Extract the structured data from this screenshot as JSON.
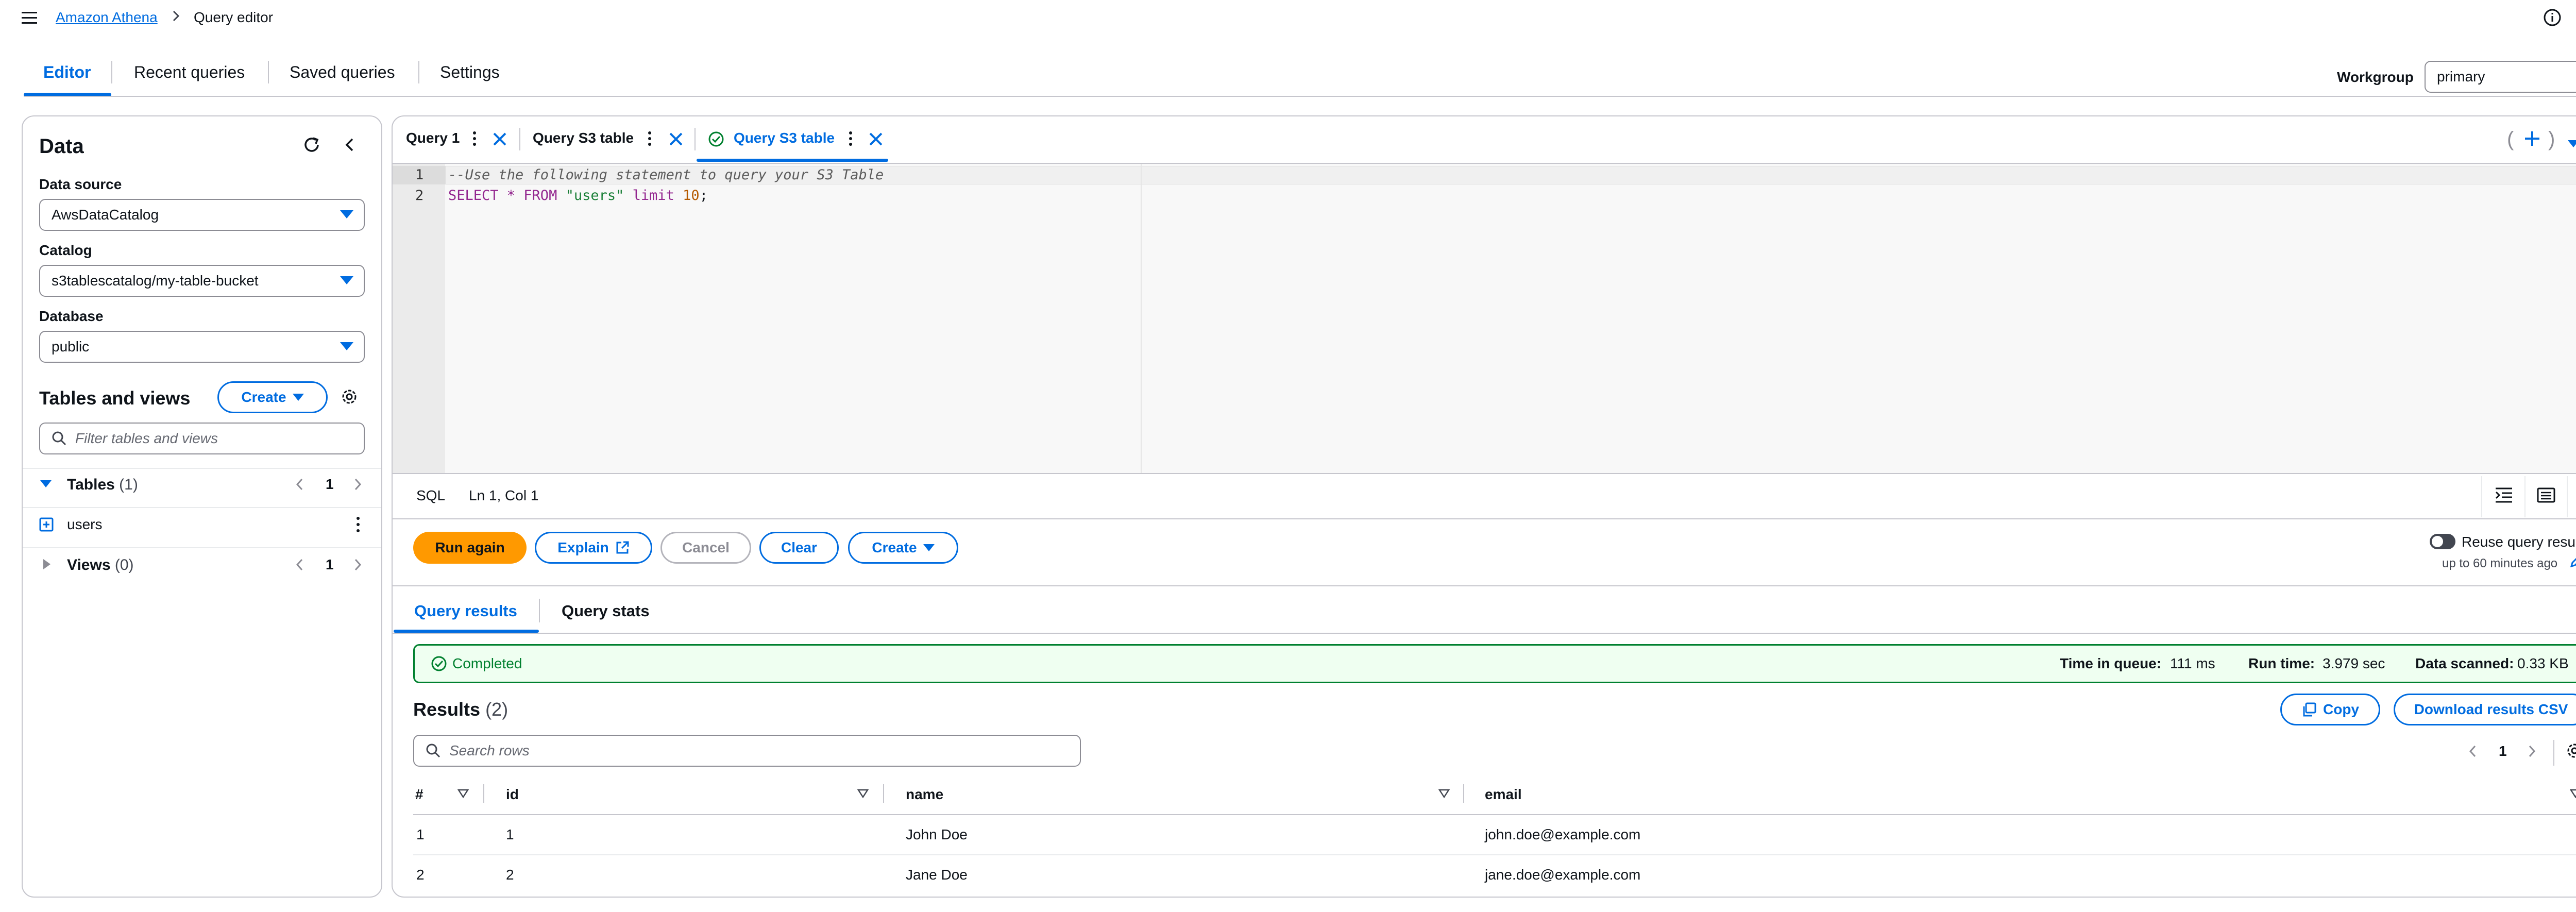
{
  "breadcrumb": {
    "service": "Amazon Athena",
    "current": "Query editor"
  },
  "page_tabs": [
    {
      "label": "Editor",
      "active": true
    },
    {
      "label": "Recent queries"
    },
    {
      "label": "Saved queries"
    },
    {
      "label": "Settings"
    }
  ],
  "workgroup": {
    "label": "Workgroup",
    "value": "primary"
  },
  "data_panel": {
    "title": "Data",
    "data_source": {
      "label": "Data source",
      "value": "AwsDataCatalog"
    },
    "catalog": {
      "label": "Catalog",
      "value": "s3tablescatalog/my-table-bucket"
    },
    "database": {
      "label": "Database",
      "value": "public"
    },
    "tables_and_views": {
      "title": "Tables and views",
      "create_label": "Create",
      "filter_placeholder": "Filter tables and views"
    },
    "tables": {
      "label": "Tables",
      "count": "(1)",
      "page": "1",
      "items": [
        "users"
      ]
    },
    "views": {
      "label": "Views",
      "count": "(0)",
      "page": "1"
    }
  },
  "query_tabs": [
    {
      "label": "Query 1"
    },
    {
      "label": "Query S3 table"
    },
    {
      "label": "Query S3 table",
      "active": true
    }
  ],
  "editor": {
    "lines": [
      {
        "num": "1",
        "text": "--Use the following statement to query your S3 Table"
      },
      {
        "num": "2",
        "parts": [
          "SELECT * FROM ",
          "\"users\"",
          " limit ",
          "10",
          ";"
        ]
      }
    ],
    "language": "SQL",
    "cursor": "Ln 1, Col 1"
  },
  "actions": {
    "run_again": "Run again",
    "explain": "Explain",
    "cancel": "Cancel",
    "clear": "Clear",
    "create": "Create",
    "reuse_label": "Reuse query results",
    "reuse_sub": "up to 60 minutes ago",
    "reuse_enabled": false
  },
  "result_tabs": [
    {
      "label": "Query results",
      "active": true
    },
    {
      "label": "Query stats"
    }
  ],
  "status": {
    "text": "Completed",
    "time_in_queue_label": "Time in queue:",
    "time_in_queue": "111 ms",
    "run_time_label": "Run time:",
    "run_time": "3.979 sec",
    "data_scanned_label": "Data scanned:",
    "data_scanned": "0.33 KB"
  },
  "results": {
    "title": "Results",
    "count": "(2)",
    "copy_label": "Copy",
    "download_label": "Download results CSV",
    "search_placeholder": "Search rows",
    "page": "1",
    "columns": [
      "#",
      "id",
      "name",
      "email"
    ],
    "rows": [
      [
        "1",
        "1",
        "John Doe",
        "john.doe@example.com"
      ],
      [
        "2",
        "2",
        "Jane Doe",
        "jane.doe@example.com"
      ]
    ]
  },
  "colors": {
    "accent": "#006ce0",
    "primary_button": "#ff9900",
    "success": "#00802f"
  }
}
